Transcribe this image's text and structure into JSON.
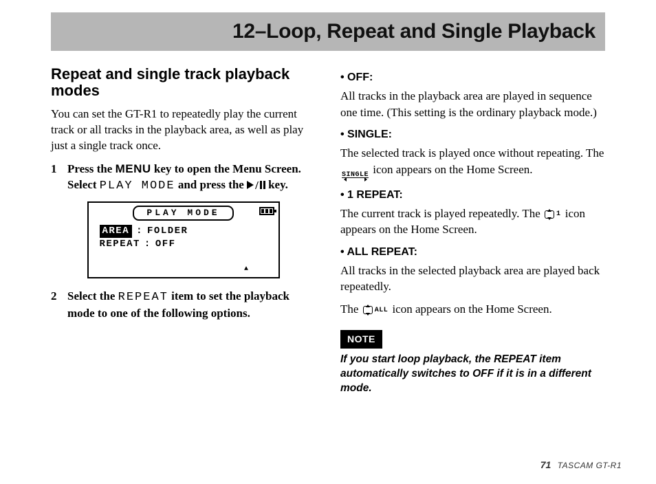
{
  "title": "12–Loop, Repeat and Single Playback",
  "left": {
    "heading": "Repeat and single track playback modes",
    "intro": "You can set the GT-R1 to repeatedly play the current track or all tracks in the playback area, as well as play just a single track once.",
    "step1_num": "1",
    "step1_a": "Press the ",
    "step1_menu": "MENU",
    "step1_b": " key to open the Menu Screen. Select ",
    "step1_mono": "PLAY MODE",
    "step1_c": " and press the ",
    "step1_d": " key.",
    "lcd": {
      "title": "PLAY MODE",
      "row1_label": "AREA",
      "row1_sep": ":",
      "row1_val": "FOLDER",
      "row2_label": "REPEAT",
      "row2_sep": ":",
      "row2_val": "OFF"
    },
    "step2_num": "2",
    "step2_a": "Select the ",
    "step2_mono": "REPEAT",
    "step2_b": " item to set the playback mode to one of the following options."
  },
  "right": {
    "off_head": "• OFF:",
    "off_body": "All tracks in the playback area are played in sequence one time. (This setting is the ordinary playback mode.)",
    "single_head": "• SINGLE:",
    "single_a": "The selected track is played once without repeating. The ",
    "single_icon_label": "SINGLE",
    "single_b": " icon appears on the Home Screen.",
    "rep1_head": "• 1 REPEAT:",
    "rep1_a": "The current track is played repeatedly. The ",
    "rep1_icon_suffix": "1",
    "rep1_b": " icon appears on the Home Screen.",
    "all_head": "• ALL REPEAT:",
    "all_a": "All tracks in the selected playback area are played back repeatedly.",
    "all_b_a": "The ",
    "all_icon_suffix": "ALL",
    "all_b_b": " icon appears on the Home Screen.",
    "note_label": "NOTE",
    "note_text": "If you start loop playback, the REPEAT item automatically switches to OFF if it is in a different mode."
  },
  "footer": {
    "page": "71",
    "model": "TASCAM  GT-R1"
  }
}
